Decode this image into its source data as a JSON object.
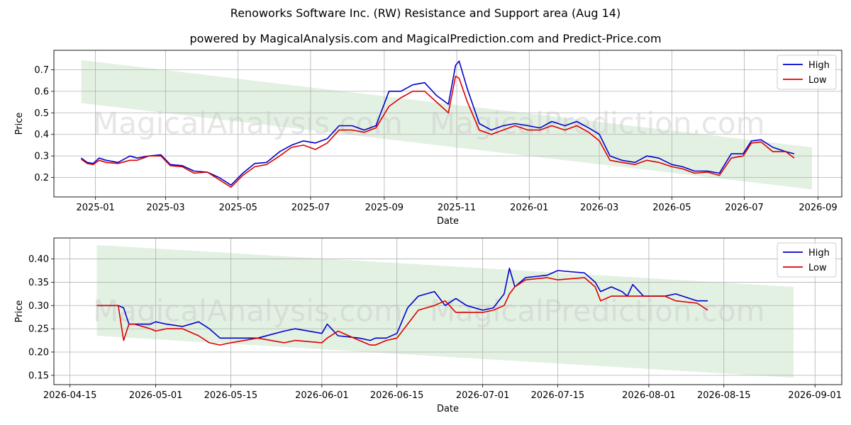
{
  "title": "Renoworks Software Inc. (RW) Resistance and Support area (Aug 14)",
  "subtitle": "powered by MagicalAnalysis.com and MagicalPrediction.com and Predict-Price.com",
  "watermark": {
    "text1": "MagicalAnalysis.com",
    "text2": "MagicalPrediction.com"
  },
  "colors": {
    "high": "#0000cc",
    "low": "#dd0000",
    "band": "#d9ecd9",
    "grid": "#b0b0b0"
  },
  "chart_data": [
    {
      "type": "line",
      "xlabel": "Date",
      "ylabel": "Price",
      "x_ticks": [
        "2025-01",
        "2025-03",
        "2025-05",
        "2025-07",
        "2025-09",
        "2025-11",
        "2026-01",
        "2026-03",
        "2026-05",
        "2026-07",
        "2026-09"
      ],
      "y_ticks": [
        "0.2",
        "0.3",
        "0.4",
        "0.5",
        "0.6",
        "0.7"
      ],
      "xlim": [
        "2024-11-27",
        "2026-09-21"
      ],
      "ylim": [
        0.11,
        0.79
      ],
      "grid": true,
      "legend": "top-right",
      "band": {
        "x": [
          "2024-12-20",
          "2026-08-27"
        ],
        "upper": [
          0.745,
          0.34
        ],
        "lower": [
          0.545,
          0.145
        ]
      },
      "series": [
        {
          "name": "High",
          "color": "#0000cc",
          "x": [
            "2024-12-20",
            "2024-12-25",
            "2024-12-30",
            "2025-01-04",
            "2025-01-10",
            "2025-01-20",
            "2025-01-30",
            "2025-02-05",
            "2025-02-15",
            "2025-02-25",
            "2025-03-05",
            "2025-03-15",
            "2025-03-25",
            "2025-04-05",
            "2025-04-15",
            "2025-04-25",
            "2025-05-05",
            "2025-05-15",
            "2025-05-25",
            "2025-06-05",
            "2025-06-15",
            "2025-06-25",
            "2025-07-05",
            "2025-07-15",
            "2025-07-25",
            "2025-08-05",
            "2025-08-15",
            "2025-08-25",
            "2025-09-05",
            "2025-09-15",
            "2025-09-25",
            "2025-10-05",
            "2025-10-15",
            "2025-10-25",
            "2025-10-31",
            "2025-11-03",
            "2025-11-10",
            "2025-11-20",
            "2025-11-30",
            "2025-12-10",
            "2025-12-20",
            "2025-12-31",
            "2026-01-10",
            "2026-01-20",
            "2026-01-31",
            "2026-02-10",
            "2026-02-20",
            "2026-03-01",
            "2026-03-10",
            "2026-03-20",
            "2026-03-31",
            "2026-04-10",
            "2026-04-20",
            "2026-05-01",
            "2026-05-10",
            "2026-05-20",
            "2026-05-31",
            "2026-06-10",
            "2026-06-20",
            "2026-06-30",
            "2026-07-07",
            "2026-07-15",
            "2026-07-25",
            "2026-08-05",
            "2026-08-12"
          ],
          "y": [
            0.29,
            0.27,
            0.265,
            0.29,
            0.28,
            0.27,
            0.3,
            0.29,
            0.3,
            0.305,
            0.26,
            0.255,
            0.23,
            0.225,
            0.2,
            0.165,
            0.22,
            0.265,
            0.27,
            0.32,
            0.35,
            0.37,
            0.36,
            0.38,
            0.44,
            0.44,
            0.42,
            0.44,
            0.6,
            0.6,
            0.63,
            0.64,
            0.58,
            0.54,
            0.72,
            0.74,
            0.61,
            0.45,
            0.42,
            0.44,
            0.45,
            0.44,
            0.43,
            0.46,
            0.44,
            0.46,
            0.43,
            0.4,
            0.3,
            0.28,
            0.27,
            0.3,
            0.29,
            0.26,
            0.25,
            0.23,
            0.23,
            0.22,
            0.31,
            0.31,
            0.37,
            0.375,
            0.34,
            0.32,
            0.31
          ]
        },
        {
          "name": "Low",
          "color": "#dd0000",
          "x": [
            "2024-12-20",
            "2024-12-25",
            "2024-12-30",
            "2025-01-04",
            "2025-01-10",
            "2025-01-20",
            "2025-01-30",
            "2025-02-05",
            "2025-02-15",
            "2025-02-25",
            "2025-03-05",
            "2025-03-15",
            "2025-03-25",
            "2025-04-05",
            "2025-04-15",
            "2025-04-25",
            "2025-05-05",
            "2025-05-15",
            "2025-05-25",
            "2025-06-05",
            "2025-06-15",
            "2025-06-25",
            "2025-07-05",
            "2025-07-15",
            "2025-07-25",
            "2025-08-05",
            "2025-08-15",
            "2025-08-25",
            "2025-09-05",
            "2025-09-15",
            "2025-09-25",
            "2025-10-05",
            "2025-10-15",
            "2025-10-25",
            "2025-10-31",
            "2025-11-03",
            "2025-11-10",
            "2025-11-20",
            "2025-11-30",
            "2025-12-10",
            "2025-12-20",
            "2025-12-31",
            "2026-01-10",
            "2026-01-20",
            "2026-01-31",
            "2026-02-10",
            "2026-02-20",
            "2026-03-01",
            "2026-03-10",
            "2026-03-20",
            "2026-03-31",
            "2026-04-10",
            "2026-04-20",
            "2026-05-01",
            "2026-05-10",
            "2026-05-20",
            "2026-05-31",
            "2026-06-10",
            "2026-06-20",
            "2026-06-30",
            "2026-07-07",
            "2026-07-15",
            "2026-07-25",
            "2026-08-05",
            "2026-08-12"
          ],
          "y": [
            0.285,
            0.265,
            0.26,
            0.28,
            0.27,
            0.265,
            0.28,
            0.28,
            0.3,
            0.3,
            0.255,
            0.25,
            0.22,
            0.225,
            0.19,
            0.155,
            0.21,
            0.25,
            0.26,
            0.3,
            0.34,
            0.35,
            0.33,
            0.36,
            0.42,
            0.42,
            0.41,
            0.43,
            0.53,
            0.57,
            0.6,
            0.6,
            0.55,
            0.5,
            0.67,
            0.66,
            0.55,
            0.42,
            0.4,
            0.42,
            0.44,
            0.42,
            0.42,
            0.44,
            0.42,
            0.44,
            0.41,
            0.37,
            0.28,
            0.27,
            0.26,
            0.28,
            0.27,
            0.25,
            0.24,
            0.22,
            0.225,
            0.21,
            0.29,
            0.3,
            0.36,
            0.365,
            0.32,
            0.32,
            0.29
          ]
        }
      ]
    },
    {
      "type": "line",
      "xlabel": "Date",
      "ylabel": "Price",
      "x_ticks": [
        "2026-04-15",
        "2026-05-01",
        "2026-05-15",
        "2026-06-01",
        "2026-06-15",
        "2026-07-01",
        "2026-07-15",
        "2026-08-01",
        "2026-08-15",
        "2026-09-01"
      ],
      "y_ticks": [
        "0.15",
        "0.20",
        "0.25",
        "0.30",
        "0.35",
        "0.40"
      ],
      "xlim": [
        "2026-04-12",
        "2026-09-06"
      ],
      "ylim": [
        0.13,
        0.445
      ],
      "grid": true,
      "legend": "top-right",
      "band": {
        "x": [
          "2026-04-20",
          "2026-08-28"
        ],
        "upper": [
          0.43,
          0.34
        ],
        "lower": [
          0.235,
          0.145
        ]
      },
      "series": [
        {
          "name": "High",
          "color": "#0000cc",
          "x": [
            "2026-04-20",
            "2026-04-24",
            "2026-04-25",
            "2026-04-26",
            "2026-04-27",
            "2026-04-30",
            "2026-05-01",
            "2026-05-03",
            "2026-05-06",
            "2026-05-09",
            "2026-05-11",
            "2026-05-13",
            "2026-05-15",
            "2026-05-20",
            "2026-05-25",
            "2026-05-27",
            "2026-06-01",
            "2026-06-02",
            "2026-06-04",
            "2026-06-08",
            "2026-06-10",
            "2026-06-11",
            "2026-06-13",
            "2026-06-15",
            "2026-06-17",
            "2026-06-19",
            "2026-06-22",
            "2026-06-24",
            "2026-06-26",
            "2026-06-28",
            "2026-07-01",
            "2026-07-03",
            "2026-07-05",
            "2026-07-06",
            "2026-07-07",
            "2026-07-09",
            "2026-07-13",
            "2026-07-15",
            "2026-07-20",
            "2026-07-22",
            "2026-07-23",
            "2026-07-25",
            "2026-07-27",
            "2026-07-28",
            "2026-07-29",
            "2026-07-31",
            "2026-08-03",
            "2026-08-04",
            "2026-08-06",
            "2026-08-10",
            "2026-08-12"
          ],
          "y": [
            0.3,
            0.3,
            0.295,
            0.26,
            0.26,
            0.26,
            0.265,
            0.26,
            0.255,
            0.265,
            0.25,
            0.23,
            0.23,
            0.23,
            0.245,
            0.25,
            0.24,
            0.26,
            0.235,
            0.23,
            0.225,
            0.23,
            0.23,
            0.24,
            0.295,
            0.32,
            0.33,
            0.3,
            0.315,
            0.3,
            0.29,
            0.295,
            0.325,
            0.38,
            0.34,
            0.36,
            0.365,
            0.375,
            0.37,
            0.35,
            0.33,
            0.34,
            0.33,
            0.32,
            0.345,
            0.32,
            0.32,
            0.32,
            0.325,
            0.31,
            0.31
          ]
        },
        {
          "name": "Low",
          "color": "#dd0000",
          "x": [
            "2026-04-20",
            "2026-04-24",
            "2026-04-25",
            "2026-04-26",
            "2026-04-27",
            "2026-04-30",
            "2026-05-01",
            "2026-05-03",
            "2026-05-06",
            "2026-05-09",
            "2026-05-11",
            "2026-05-13",
            "2026-05-15",
            "2026-05-20",
            "2026-05-25",
            "2026-05-27",
            "2026-06-01",
            "2026-06-02",
            "2026-06-04",
            "2026-06-08",
            "2026-06-10",
            "2026-06-11",
            "2026-06-13",
            "2026-06-15",
            "2026-06-17",
            "2026-06-19",
            "2026-06-22",
            "2026-06-24",
            "2026-06-26",
            "2026-06-28",
            "2026-07-01",
            "2026-07-03",
            "2026-07-05",
            "2026-07-06",
            "2026-07-07",
            "2026-07-09",
            "2026-07-13",
            "2026-07-15",
            "2026-07-20",
            "2026-07-22",
            "2026-07-23",
            "2026-07-25",
            "2026-07-27",
            "2026-07-28",
            "2026-07-29",
            "2026-07-31",
            "2026-08-03",
            "2026-08-04",
            "2026-08-06",
            "2026-08-10",
            "2026-08-12"
          ],
          "y": [
            0.3,
            0.3,
            0.225,
            0.26,
            0.26,
            0.25,
            0.245,
            0.25,
            0.25,
            0.235,
            0.22,
            0.215,
            0.22,
            0.23,
            0.22,
            0.225,
            0.22,
            0.23,
            0.245,
            0.225,
            0.215,
            0.215,
            0.225,
            0.23,
            0.26,
            0.29,
            0.3,
            0.31,
            0.285,
            0.285,
            0.285,
            0.29,
            0.3,
            0.325,
            0.34,
            0.355,
            0.36,
            0.355,
            0.36,
            0.34,
            0.31,
            0.32,
            0.32,
            0.32,
            0.32,
            0.32,
            0.32,
            0.32,
            0.31,
            0.305,
            0.29
          ]
        }
      ]
    }
  ]
}
